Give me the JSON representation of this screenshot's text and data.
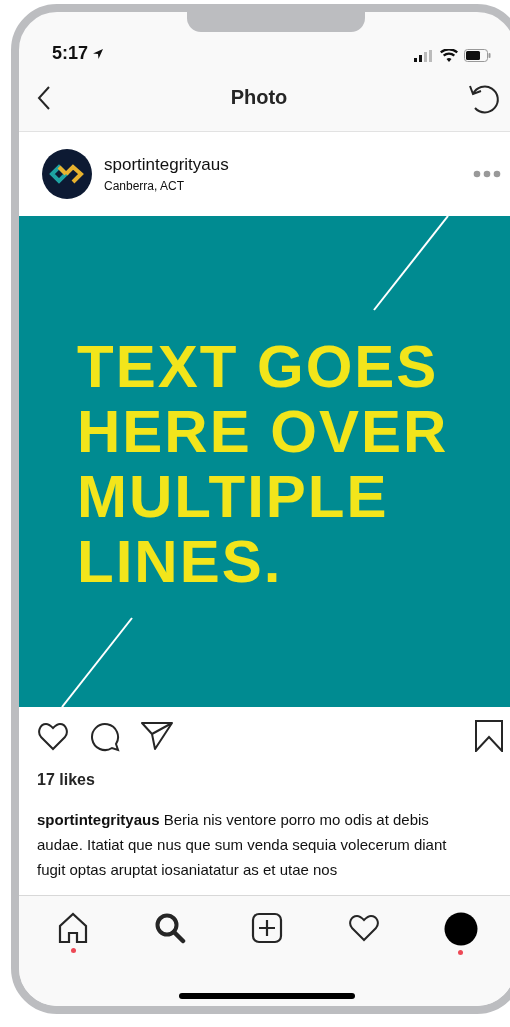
{
  "status_bar": {
    "time": "5:17"
  },
  "nav": {
    "title": "Photo"
  },
  "post": {
    "username": "sportintegrityaus",
    "location": "Canberra, ACT",
    "image_lines": [
      "TEXT GOES",
      "HERE OVER",
      "MULTIPLE",
      "LINES."
    ],
    "likes": "17 likes",
    "caption": "**sportintegrityaus** Beria nis ventore porro mo odis at debis audae. Itatiat que nus que sum venda sequia volecerum diant fugit optas aruptat iosaniatatur as et utae nos"
  },
  "tab_bar": [
    {
      "kind": "home",
      "dot": true
    },
    {
      "kind": "search",
      "dot": false
    },
    {
      "kind": "add",
      "dot": false
    },
    {
      "kind": "activity",
      "dot": false
    },
    {
      "kind": "profile",
      "dot": true
    }
  ]
}
